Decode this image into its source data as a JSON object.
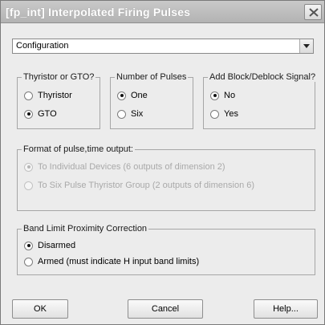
{
  "window": {
    "title": "[fp_int] Interpolated Firing Pulses"
  },
  "config_select": {
    "value": "Configuration"
  },
  "thyristor_group": {
    "legend": "Thyristor or GTO?",
    "options": [
      {
        "label": "Thyristor",
        "selected": false
      },
      {
        "label": "GTO",
        "selected": true
      }
    ]
  },
  "pulses_group": {
    "legend": "Number of Pulses",
    "options": [
      {
        "label": "One",
        "selected": true
      },
      {
        "label": "Six",
        "selected": false
      }
    ]
  },
  "block_group": {
    "legend": "Add Block/Deblock Signal?",
    "options": [
      {
        "label": "No",
        "selected": true
      },
      {
        "label": "Yes",
        "selected": false
      }
    ]
  },
  "format_group": {
    "legend": "Format of pulse,time output:",
    "enabled": false,
    "options": [
      {
        "label": "To Individual Devices (6 outputs of dimension 2)",
        "selected": true
      },
      {
        "label": "To Six Pulse Thyristor Group (2 outputs of dimension 6)",
        "selected": false
      }
    ]
  },
  "band_group": {
    "legend": "Band Limit Proximity Correction",
    "options": [
      {
        "label": "Disarmed",
        "selected": true
      },
      {
        "label": "Armed (must indicate H input band limits)",
        "selected": false
      }
    ]
  },
  "buttons": {
    "ok": "OK",
    "cancel": "Cancel",
    "help": "Help..."
  }
}
